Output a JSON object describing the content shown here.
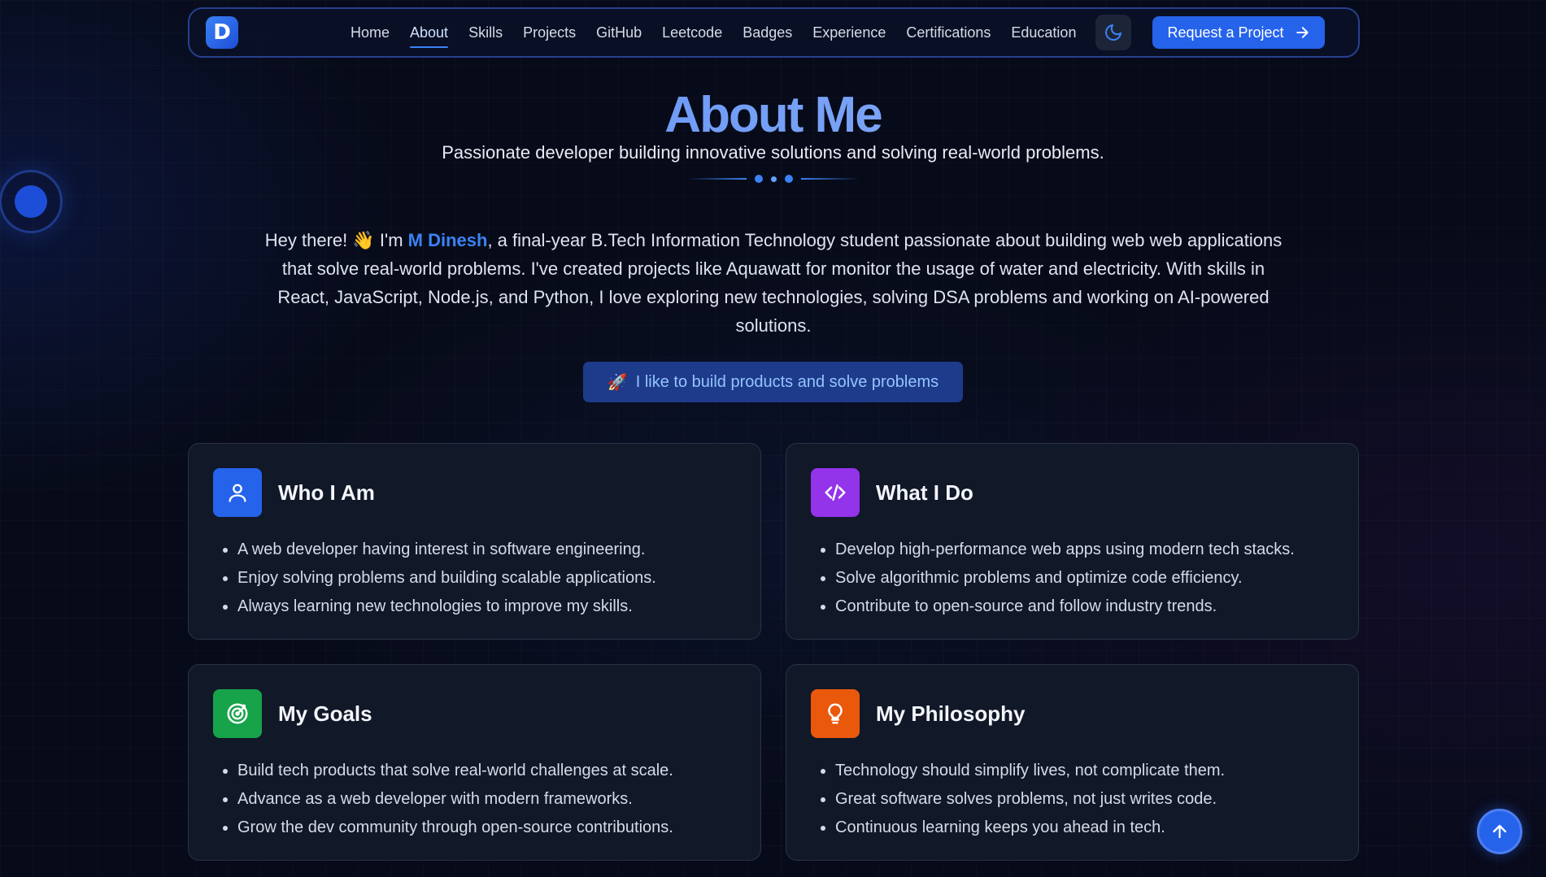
{
  "nav": {
    "logo_letter": "D",
    "links": [
      "Home",
      "About",
      "Skills",
      "Projects",
      "GitHub",
      "Leetcode",
      "Badges",
      "Experience",
      "Certifications",
      "Education"
    ],
    "active": "About",
    "theme_icon": "moon-icon",
    "request_label": "Request a Project"
  },
  "header": {
    "title": "About Me",
    "subtitle": "Passionate developer building innovative solutions and solving real-world problems."
  },
  "intro": {
    "greeting": "Hey there! ",
    "wave_emoji": "👋",
    "im": " I'm ",
    "name": "M Dinesh",
    "rest": ", a final-year B.Tech Information Technology student passionate about building web web applications that solve real-world problems. I've created projects like Aquawatt for monitor the usage of water and electricity. With skills in React, JavaScript, Node.js, and Python, I love exploring new technologies, solving DSA problems and working on AI-powered solutions."
  },
  "pill": {
    "emoji": "🚀",
    "label": "I like to build products and solve problems"
  },
  "cards": [
    {
      "title": "Who I Am",
      "icon": "user-icon",
      "color": "#2563eb",
      "items": [
        "A web developer having interest in software engineering.",
        "Enjoy solving problems and building scalable applications.",
        "Always learning new technologies to improve my skills."
      ]
    },
    {
      "title": "What I Do",
      "icon": "code-icon",
      "color": "#9333ea",
      "items": [
        "Develop high-performance web apps using modern tech stacks.",
        "Solve algorithmic problems and optimize code efficiency.",
        "Contribute to open-source and follow industry trends."
      ]
    },
    {
      "title": "My Goals",
      "icon": "target-icon",
      "color": "#16a34a",
      "items": [
        "Build tech products that solve real-world challenges at scale.",
        "Advance as a web developer with modern frameworks.",
        "Grow the dev community through open-source contributions."
      ]
    },
    {
      "title": "My Philosophy",
      "icon": "lightbulb-icon",
      "color": "#ea580c",
      "items": [
        "Technology should simplify lives, not complicate them.",
        "Great software solves problems, not just writes code.",
        "Continuous learning keeps you ahead in tech."
      ]
    }
  ],
  "scroll_top_icon": "arrow-up-icon"
}
